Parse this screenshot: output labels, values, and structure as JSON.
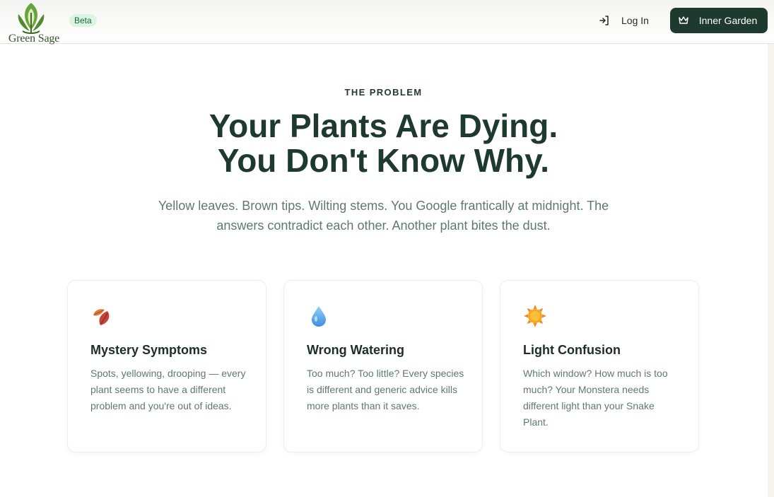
{
  "header": {
    "brand": "Green Sage",
    "badge": "Beta",
    "login_label": "Log In",
    "cta_label": "Inner Garden"
  },
  "hero": {
    "eyebrow": "THE PROBLEM",
    "headline_line1": "Your Plants Are Dying.",
    "headline_line2": "You Don't Know Why.",
    "subtext": "Yellow leaves. Brown tips. Wilting stems. You Google frantically at midnight. The answers contradict each other. Another plant bites the dust."
  },
  "cards": [
    {
      "icon": "fallen-leaves-icon",
      "title": "Mystery Symptoms",
      "description": "Spots, yellowing, drooping — every plant seems to have a different problem and you're out of ideas."
    },
    {
      "icon": "water-drop-icon",
      "title": "Wrong Watering",
      "description": "Too much? Too little? Every species is different and generic advice kills more plants than it saves."
    },
    {
      "icon": "sun-icon",
      "title": "Light Confusion",
      "description": "Which window? How much is too much? Your Monstera needs different light than your Snake Plant."
    }
  ],
  "colors": {
    "primary_dark": "#1e3a2f",
    "badge_bg": "#dcf5e3",
    "muted_text": "#5f7a6b"
  }
}
